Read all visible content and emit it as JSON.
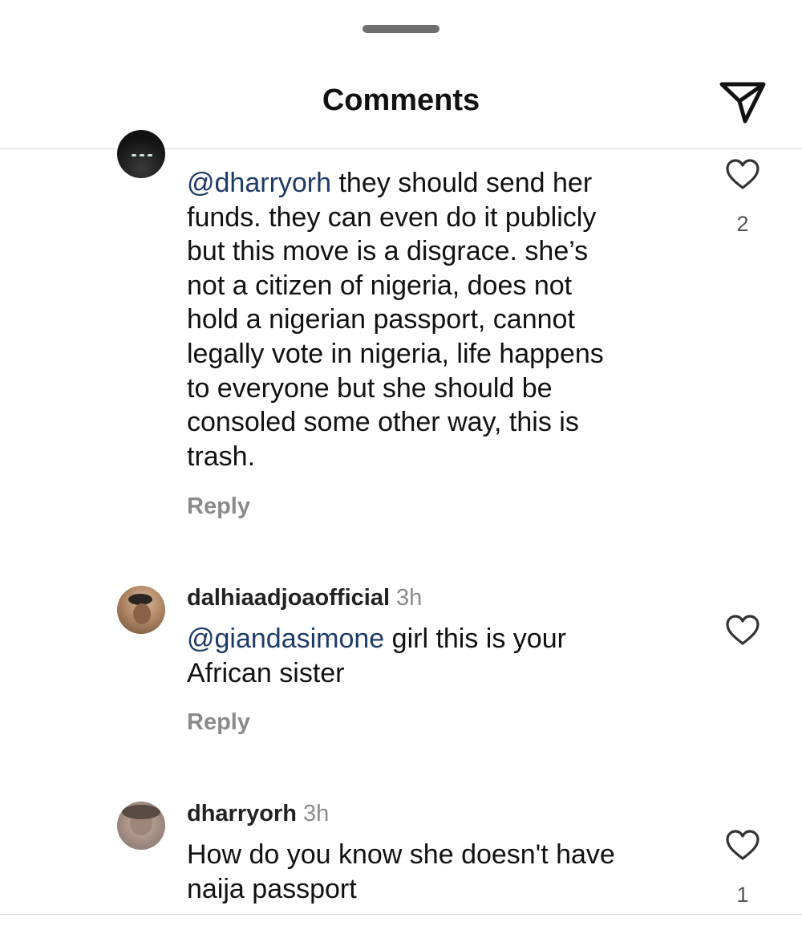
{
  "header": {
    "title": "Comments",
    "share_icon": "paper-plane-icon"
  },
  "comments": [
    {
      "username": "",
      "time": "",
      "mention": "@dharryorh",
      "text_lines": [
        " they should send her",
        "funds. they can even do it publicly",
        "but this move is a disgrace. she’s",
        "not a citizen of nigeria, does not",
        "hold a nigerian passport, cannot",
        "legally vote in nigeria, life happens",
        "to everyone but she should be",
        "consoled some other way, this is",
        "trash."
      ],
      "reply_label": "Reply",
      "like_count": "2",
      "like_icon": "heart-outline-icon"
    },
    {
      "username": "dalhiaadjoaofficial",
      "time": "3h",
      "mention": "@giandasimone",
      "text_lines": [
        " girl this is your",
        "African sister"
      ],
      "reply_label": "Reply",
      "like_count": "",
      "like_icon": "heart-outline-icon"
    },
    {
      "username": "dharryorh",
      "time": "3h",
      "mention": "",
      "text_lines": [
        "How do you know she doesn't have",
        "naija passport"
      ],
      "reply_label": "",
      "like_count": "1",
      "like_icon": "heart-outline-icon"
    }
  ],
  "colors": {
    "mention": "#1e3a66",
    "muted": "#8a8a8a",
    "text": "#111111"
  }
}
